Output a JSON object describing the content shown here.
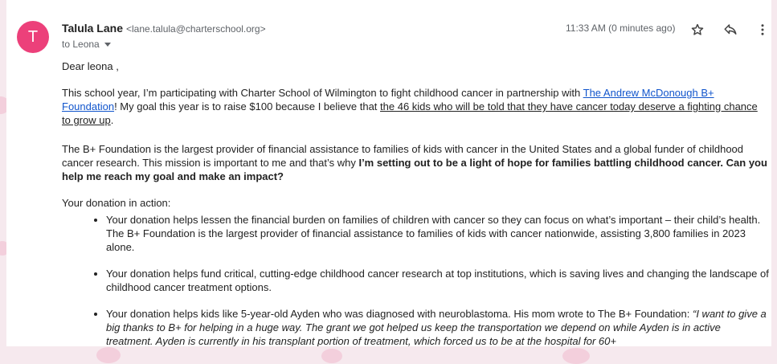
{
  "sender": {
    "avatar_letter": "T",
    "name": "Talula Lane",
    "email": "<lane.talula@charterschool.org>",
    "to_label": "to Leona",
    "time": "11:33 AM (0 minutes ago)"
  },
  "icons": [
    "star-icon",
    "reply-icon",
    "more-vert-icon",
    "chevron-down-icon"
  ],
  "colors": {
    "avatar": "#ec407a",
    "link": "#1155cc"
  },
  "message": {
    "greeting": "Dear leona ,",
    "p1_a": "This school year, I’m participating with Charter School of Wilmington to fight childhood cancer in partnership with ",
    "p1_link": "The Andrew McDonough B+ Foundation",
    "p1_b": "! My goal this year is to raise $100 because I believe that ",
    "p1_underline": "the 46 kids who will be told that they have cancer today deserve a fighting chance to grow up",
    "p1_c": ".",
    "p2_a": "The B+ Foundation is the largest provider of financial assistance to families of kids with cancer in the United States and a global funder of childhood cancer research. This mission is important to me and that’s why ",
    "p2_bold": "I’m setting out to be a light of hope for families battling childhood cancer. Can you help me reach my goal and make an impact?",
    "p3": "Your donation in action:",
    "bullets": [
      "Your donation helps lessen the financial burden on families of children with cancer so they can focus on what’s important – their child’s health. The B+ Foundation is the largest provider of financial assistance to families of kids with cancer nationwide, assisting 3,800 families in 2023 alone.",
      "Your donation helps fund critical, cutting-edge childhood cancer research at top institutions, which is saving lives and changing the landscape of childhood cancer treatment options."
    ],
    "bullet3_a": "Your donation helps kids like 5-year-old Ayden who was diagnosed with neuroblastoma. His mom wrote to The B+ Foundation: ",
    "bullet3_quote": "“I want to give a big thanks to B+ for helping in a huge way. The grant we got helped us keep the transportation we depend on while Ayden is in active treatment.  Ayden is currently in his transplant portion of treatment, which forced us to be at the hospital for 60+"
  }
}
